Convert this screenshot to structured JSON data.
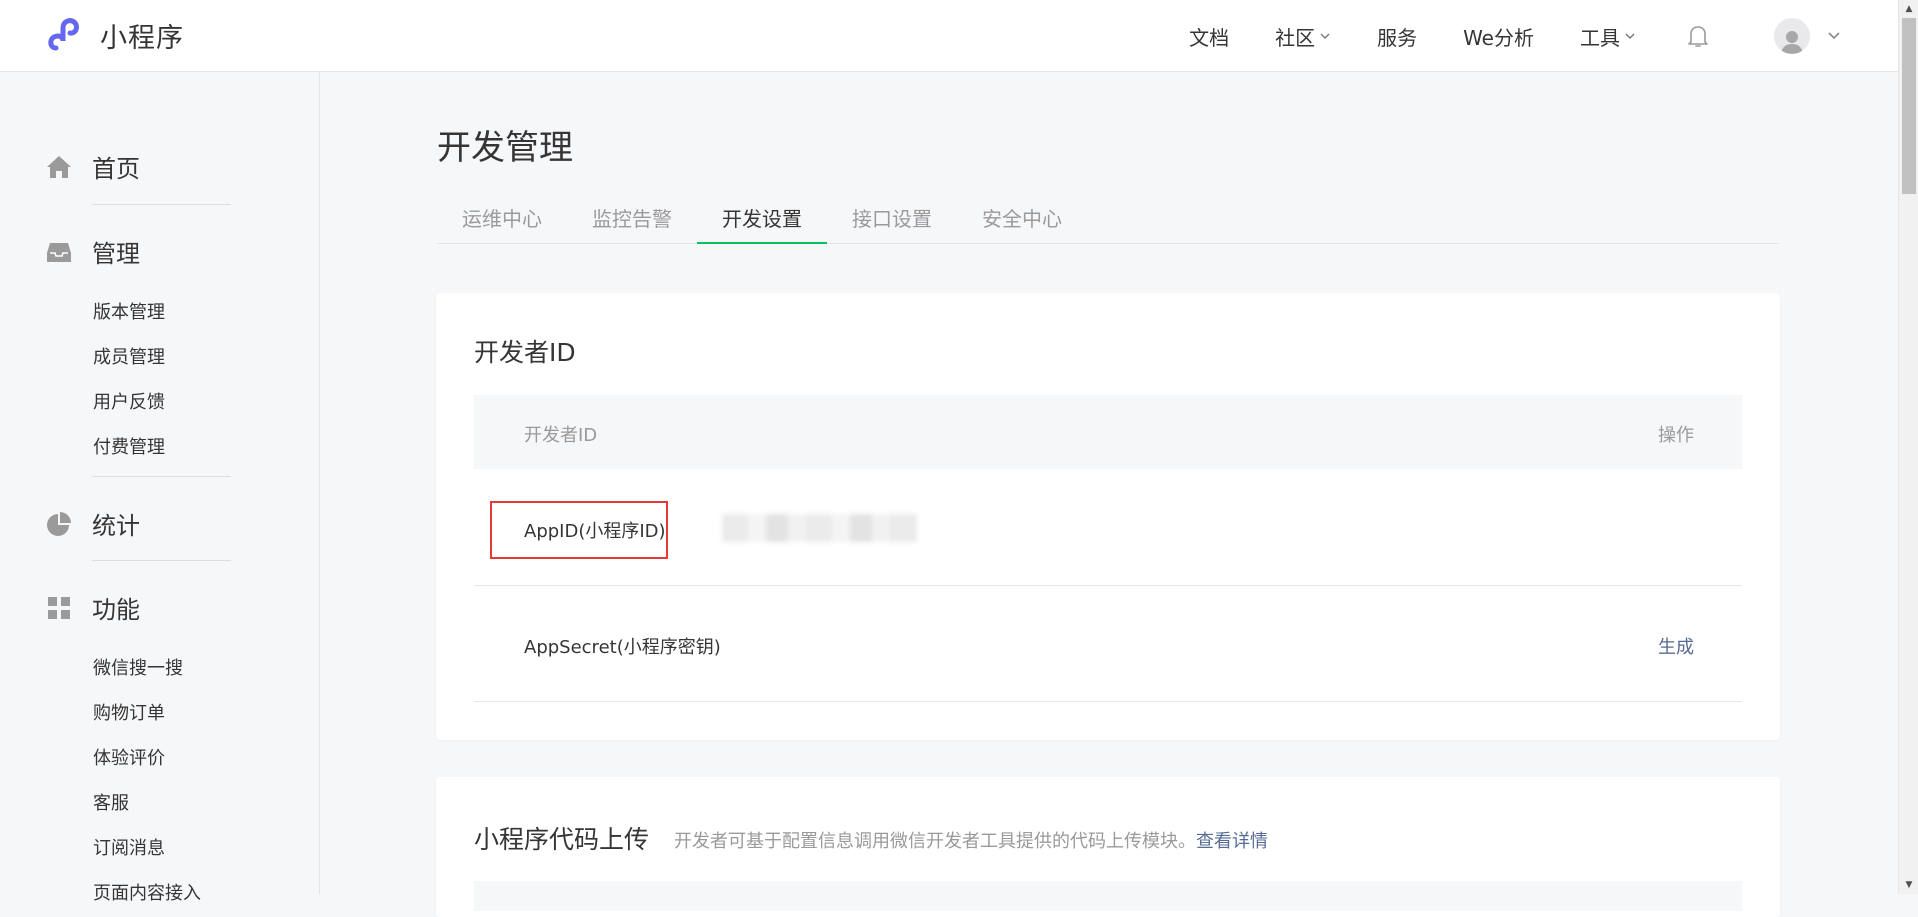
{
  "app": {
    "name": "小程序"
  },
  "topnav": {
    "items": [
      {
        "label": "文档",
        "has_dropdown": false
      },
      {
        "label": "社区",
        "has_dropdown": true
      },
      {
        "label": "服务",
        "has_dropdown": false
      },
      {
        "label": "We分析",
        "has_dropdown": false
      },
      {
        "label": "工具",
        "has_dropdown": true
      }
    ],
    "icons": [
      "bell-icon",
      "avatar-icon",
      "chevron-down-icon"
    ]
  },
  "sidebar": {
    "groups": [
      {
        "label": "首页",
        "icon": "home-icon",
        "items": []
      },
      {
        "label": "管理",
        "icon": "inbox-icon",
        "items": [
          "版本管理",
          "成员管理",
          "用户反馈",
          "付费管理"
        ]
      },
      {
        "label": "统计",
        "icon": "pie-chart-icon",
        "items": []
      },
      {
        "label": "功能",
        "icon": "grid-icon",
        "items": [
          "微信搜一搜",
          "购物订单",
          "体验评价",
          "客服",
          "订阅消息",
          "页面内容接入"
        ]
      }
    ]
  },
  "main": {
    "title": "开发管理",
    "tabs": [
      {
        "label": "运维中心",
        "active": false
      },
      {
        "label": "监控告警",
        "active": false
      },
      {
        "label": "开发设置",
        "active": true
      },
      {
        "label": "接口设置",
        "active": false
      },
      {
        "label": "安全中心",
        "active": false
      }
    ],
    "developer_id": {
      "title": "开发者ID",
      "columns": [
        "开发者ID",
        "操作"
      ],
      "rows": [
        {
          "label": "AppID(小程序ID)",
          "value": "",
          "action": ""
        },
        {
          "label": "AppSecret(小程序密钥)",
          "value": "",
          "action": "生成"
        }
      ]
    },
    "code_upload": {
      "title": "小程序代码上传",
      "description": "开发者可基于配置信息调用微信开发者工具提供的代码上传模块。",
      "link": "查看详情"
    }
  },
  "colors": {
    "accent_green": "#07c160",
    "link_blue": "#576b95",
    "highlight_red": "#e53935",
    "logo_purple": "#6467f0"
  }
}
